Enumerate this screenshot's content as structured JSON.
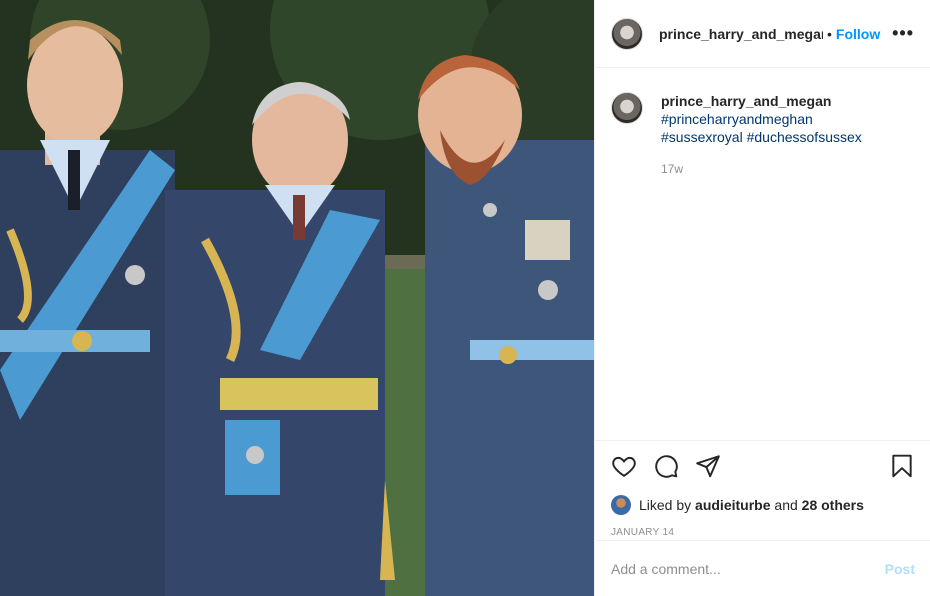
{
  "header": {
    "username": "prince_harry_and_megar",
    "separator": "•",
    "follow_label": "Follow",
    "more_label": "•••"
  },
  "caption": {
    "username": "prince_harry_and_megan",
    "hashtags": [
      "#princeharryandmeghan",
      "#sussexroyal",
      "#duchessofsussex"
    ],
    "time": "17w"
  },
  "actions": {
    "icons": [
      "heart-icon",
      "comment-icon",
      "share-icon",
      "bookmark-icon"
    ]
  },
  "likes": {
    "prefix": "Liked by",
    "user": "audieiturbe",
    "middle": "and",
    "others": "28 others"
  },
  "date": "JANUARY 14",
  "comment": {
    "placeholder": "Add a comment...",
    "post_label": "Post"
  },
  "colors": {
    "accent": "#0095f6",
    "link": "#00376b",
    "post_disabled": "#b2dffc",
    "border": "#efefef"
  }
}
